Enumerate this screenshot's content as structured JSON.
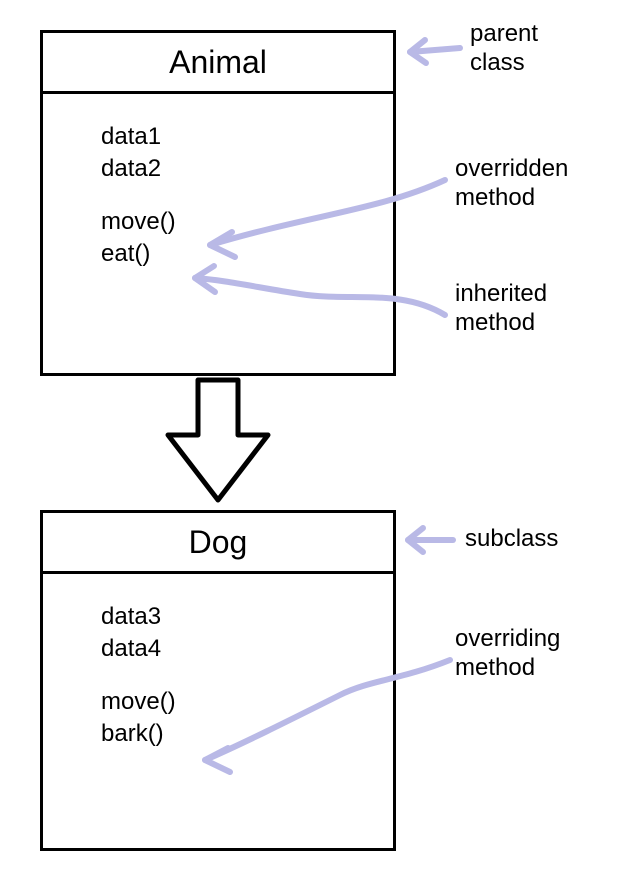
{
  "parent": {
    "title": "Animal",
    "data": [
      "data1",
      "data2"
    ],
    "methods": [
      "move()",
      "eat()"
    ]
  },
  "child": {
    "title": "Dog",
    "data": [
      "data3",
      "data4"
    ],
    "methods": [
      "move()",
      "bark()"
    ]
  },
  "labels": {
    "parent_class_l1": "parent",
    "parent_class_l2": "class",
    "overridden_l1": "overridden",
    "overridden_l2": "method",
    "inherited_l1": "inherited",
    "inherited_l2": "method",
    "subclass": "subclass",
    "overriding_l1": "overriding",
    "overriding_l2": "method"
  }
}
